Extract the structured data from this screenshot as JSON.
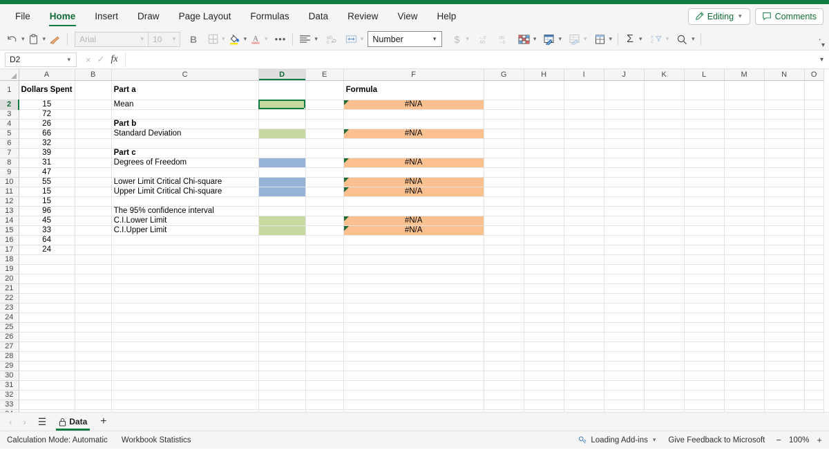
{
  "app": {
    "active_tab": "Home"
  },
  "ribbon": {
    "tabs": [
      {
        "label": "File"
      },
      {
        "label": "Home"
      },
      {
        "label": "Insert"
      },
      {
        "label": "Draw"
      },
      {
        "label": "Page Layout"
      },
      {
        "label": "Formulas"
      },
      {
        "label": "Data"
      },
      {
        "label": "Review"
      },
      {
        "label": "View"
      },
      {
        "label": "Help"
      }
    ],
    "editing_label": "Editing",
    "comments_label": "Comments",
    "accent_color": "#107c41"
  },
  "toolbar": {
    "font_name": "Arial",
    "font_size": "10",
    "bold_label": "B",
    "more_label": "•••",
    "number_format": "Number",
    "currency_label": "$",
    "icons": [
      "undo-icon",
      "paste-icon",
      "format-painter-icon",
      "bold-icon",
      "borders-icon",
      "fill-color-icon",
      "font-color-icon",
      "more-options-icon",
      "align-icon",
      "wrap-text-icon",
      "merge-cells-icon",
      "currency-icon",
      "decrease-decimal-icon",
      "increase-decimal-icon",
      "conditional-formatting-icon",
      "format-as-table-icon",
      "cell-styles-icon",
      "insert-cells-icon",
      "autosum-icon",
      "sort-filter-icon",
      "find-icon"
    ]
  },
  "formula_bar": {
    "name_box": "D2",
    "value": "",
    "cancel_label": "×",
    "enter_label": "✓",
    "fx_label": "fx"
  },
  "grid": {
    "columns": [
      "A",
      "B",
      "C",
      "D",
      "E",
      "F",
      "G",
      "H",
      "I",
      "J",
      "K",
      "L",
      "M",
      "N",
      "O"
    ],
    "selected_column": "D",
    "selected_row": 2,
    "selected_cell": "D2",
    "row_count": 34,
    "colors": {
      "green_fill": "#c6d9a0",
      "blue_fill": "#95b3d7",
      "orange_fill": "#fac090",
      "selection_border": "#107c41",
      "error_triangle": "#1f6b2f"
    },
    "column_a": {
      "header": "Dollars Spent",
      "values": [
        15,
        72,
        26,
        66,
        32,
        39,
        31,
        47,
        55,
        15,
        15,
        96,
        45,
        33,
        64,
        24
      ]
    },
    "column_c": [
      {
        "row": 1,
        "text": "Part a",
        "bold": true
      },
      {
        "row": 2,
        "text": "Mean",
        "bold": false
      },
      {
        "row": 4,
        "text": "Part b",
        "bold": true
      },
      {
        "row": 5,
        "text": "Standard Deviation",
        "bold": false
      },
      {
        "row": 7,
        "text": "Part c",
        "bold": true
      },
      {
        "row": 8,
        "text": "Degrees of Freedom",
        "bold": false
      },
      {
        "row": 10,
        "text": "Lower Limit Critical Chi-square",
        "bold": false
      },
      {
        "row": 11,
        "text": "Upper Limit Critical Chi-square",
        "bold": false
      },
      {
        "row": 13,
        "text": "The 95% confidence  interval",
        "bold": false
      },
      {
        "row": 14,
        "text": "C.I.Lower Limit",
        "bold": false
      },
      {
        "row": 15,
        "text": "C.I.Upper Limit",
        "bold": false
      }
    ],
    "column_d": [
      {
        "row": 2,
        "fill": "green",
        "selected": true
      },
      {
        "row": 5,
        "fill": "green"
      },
      {
        "row": 8,
        "fill": "blue"
      },
      {
        "row": 10,
        "fill": "blue"
      },
      {
        "row": 11,
        "fill": "blue"
      },
      {
        "row": 14,
        "fill": "green"
      },
      {
        "row": 15,
        "fill": "green"
      }
    ],
    "column_f": [
      {
        "row": 1,
        "text": "Formula",
        "bold": true,
        "fill": "none",
        "error": false
      },
      {
        "row": 2,
        "text": "#N/A",
        "fill": "orange",
        "error": true
      },
      {
        "row": 5,
        "text": "#N/A",
        "fill": "orange",
        "error": true
      },
      {
        "row": 8,
        "text": "#N/A",
        "fill": "orange",
        "error": true
      },
      {
        "row": 10,
        "text": "#N/A",
        "fill": "orange",
        "error": true
      },
      {
        "row": 11,
        "text": "#N/A",
        "fill": "orange",
        "error": true
      },
      {
        "row": 14,
        "text": "#N/A",
        "fill": "orange",
        "error": true
      },
      {
        "row": 15,
        "text": "#N/A",
        "fill": "orange",
        "error": true
      }
    ]
  },
  "sheet_tabs": {
    "tabs": [
      {
        "label": "Data",
        "locked": true,
        "active": true
      }
    ],
    "add_label": "+",
    "prev_label": "‹",
    "next_label": "›"
  },
  "status_bar": {
    "calculation_mode": "Calculation Mode: Automatic",
    "workbook_statistics": "Workbook Statistics",
    "addins": "Loading Add-ins",
    "feedback": "Give Feedback to Microsoft",
    "zoom": "100%",
    "zoom_out": "−",
    "zoom_in": "+"
  }
}
